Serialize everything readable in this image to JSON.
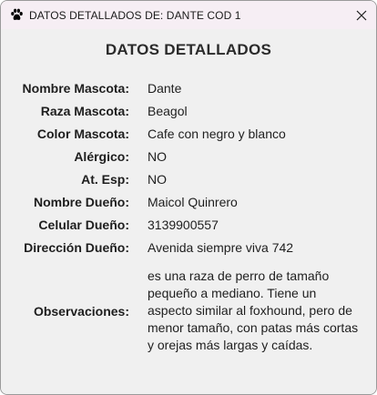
{
  "window": {
    "title": "DATOS DETALLADOS DE: DANTE COD 1",
    "icon": "paw-icon",
    "close_icon": "close-icon"
  },
  "heading": "DATOS DETALLADOS",
  "fields": [
    {
      "label": "Nombre Mascota:",
      "value": "Dante"
    },
    {
      "label": "Raza Mascota:",
      "value": "Beagol"
    },
    {
      "label": "Color Mascota:",
      "value": "Cafe con negro y blanco"
    },
    {
      "label": "Alérgico:",
      "value": "NO"
    },
    {
      "label": "At. Esp:",
      "value": "NO"
    },
    {
      "label": "Nombre Dueño:",
      "value": "Maicol Quinrero"
    },
    {
      "label": "Celular Dueño:",
      "value": "3139900557"
    },
    {
      "label": "Dirección Dueño:",
      "value": "Avenida siempre viva 742"
    }
  ],
  "observations": {
    "label": "Observaciones:",
    "value": "es una raza de perro de tamaño pequeño a mediano. Tiene un aspecto similar al foxhound, pero de menor tamaño, con patas más cortas y orejas más largas y caídas."
  }
}
